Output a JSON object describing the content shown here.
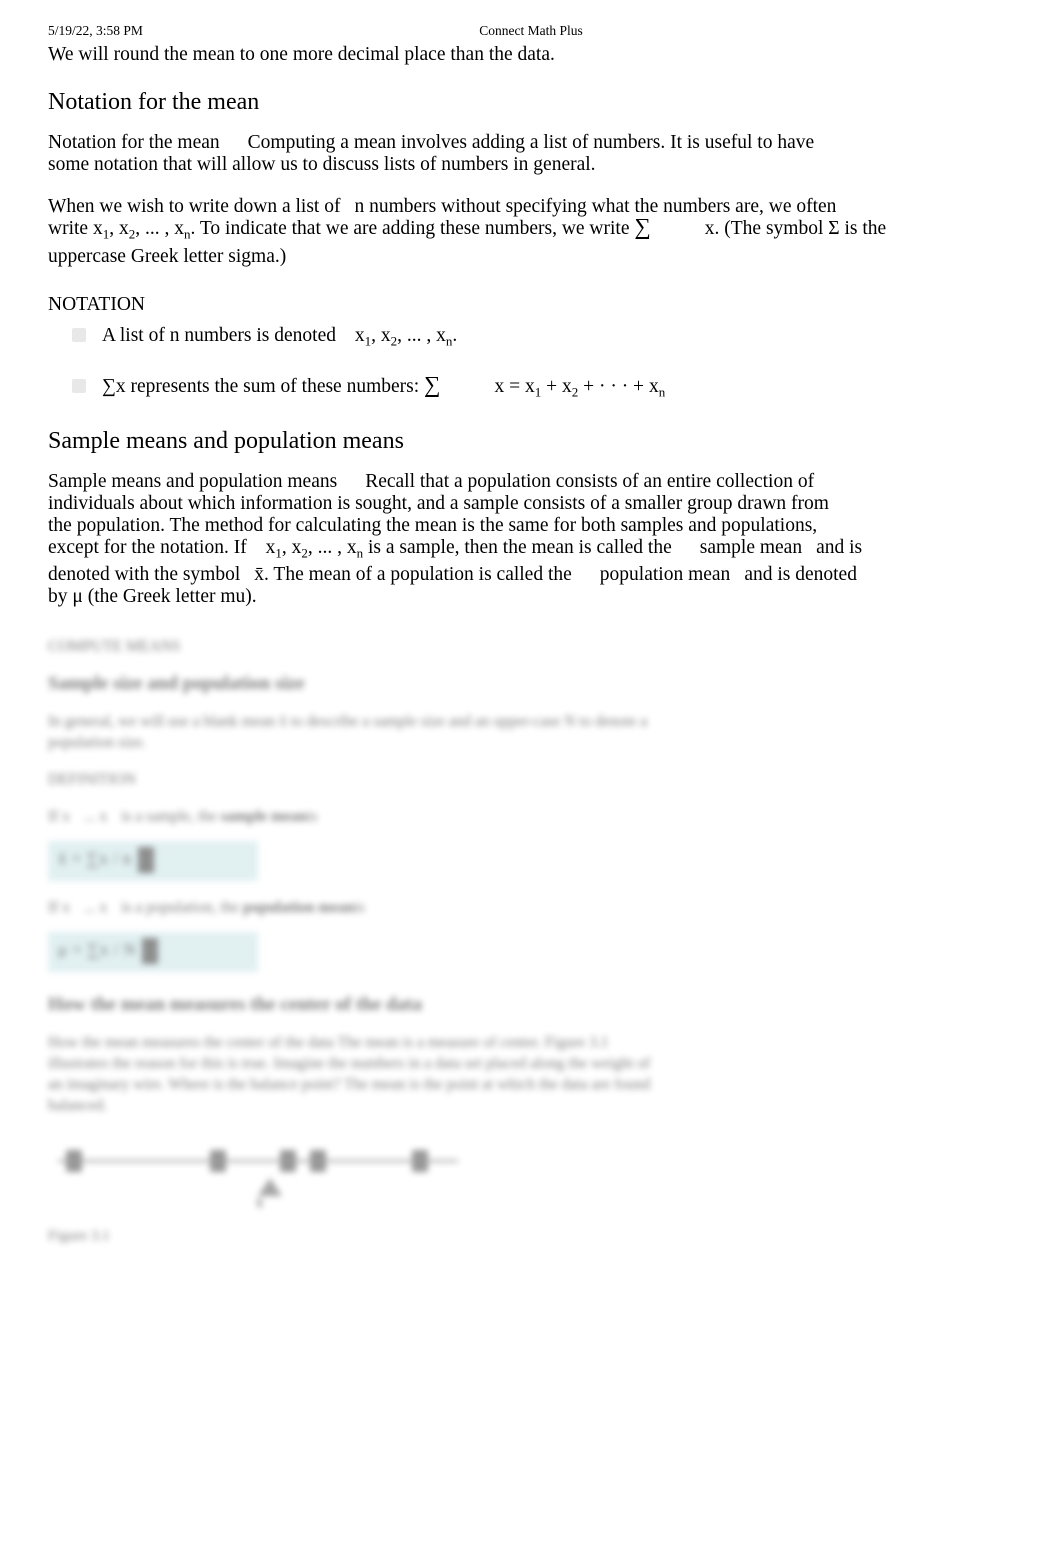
{
  "header": {
    "date": "5/19/22, 3:58 PM",
    "title": "Connect Math Plus"
  },
  "intro": {
    "rounding_note": "We will round the mean to one more decimal place than the data."
  },
  "sections": [
    {
      "heading": "Notation for the mean",
      "lead_label": "Notation for the mean",
      "paragraph_1a": "Computing a mean involves adding a list of numbers. It is useful to have",
      "paragraph_1b": "some notation that will allow us to discuss lists of numbers in general.",
      "paragraph_2": {
        "line1_a": "When we wish to write down a list of",
        "line1_b": "n numbers without specifying what the numbers are, we often",
        "line2_a": "write",
        "line2_x1": "x",
        "line2_sub1": "1",
        "line2_x2": "x",
        "line2_sub2": "2",
        "line2_ellipsis": ", ... ,",
        "line2_xn": "x",
        "line2_subn": "n",
        "line2_b": ". To indicate that we are adding these numbers, we write",
        "line2_sigma": "∑",
        "line2_c": "x. (The symbol Σ is the",
        "line3": "uppercase Greek letter sigma.)"
      },
      "notation_label": "NOTATION",
      "bullets": [
        {
          "text_a": "A list of",
          "text_n": "n numbers is denoted",
          "x1": "x",
          "s1": "1",
          "x2": "x",
          "s2": "2",
          "ellipsis": ", ... ,",
          "xn": "x",
          "sn": "n",
          "period": "."
        },
        {
          "text_a": "∑x represents the sum of these numbers:",
          "sigma": "∑",
          "eq": "x = x",
          "s1": "1",
          "plus1": "+ x",
          "s2": "2",
          "plus2": "+ · · · +",
          "xn": "x",
          "sn": "n"
        }
      ]
    },
    {
      "heading": "Sample means and population means",
      "lead_label": "Sample means and population means",
      "paragraph": {
        "line1_b": "Recall that a population consists of an entire collection of",
        "line2": "individuals about which information is sought, and a sample consists of a smaller group drawn from",
        "line3": "the population. The method for calculating the mean is the same for both samples and populations,",
        "line4_a": "except for the notation. If",
        "line4_x1": "x",
        "line4_s1": "1",
        "line4_x2": "x",
        "line4_s2": "2",
        "line4_ellipsis": ", ... ,",
        "line4_xn": "x",
        "line4_sn": "n",
        "line4_b": "is a sample, then the mean is called the",
        "line4_em": "sample mean",
        "line4_c": "and is",
        "line5_a": "denoted with the symbol",
        "line5_symbol": "x̄",
        "line5_b": ". The mean of a population is called the",
        "line5_em": "population mean",
        "line5_c": "and is denoted",
        "line6": "by μ (the Greek letter mu)."
      }
    }
  ],
  "blurred": {
    "label_definition_1": "COMPUTE MEANS",
    "heading_1": "Sample size and population size",
    "paragraph_1a": "In general, we will use a blank mean x̄ to describe a sample size and an upper-case N to denote a",
    "paragraph_1b": "population size.",
    "label_definition_2": "DEFINITION",
    "def_line_1a": "If x",
    "def_line_1b": "... x",
    "def_line_1c": "is a sample, the",
    "def_line_1d": "sample mean",
    "def_line_1e": "is",
    "formula_1": "x̄ = ∑x / n",
    "def_line_2a": "If x",
    "def_line_2b": "... x",
    "def_line_2c": "is a population, the",
    "def_line_2d": "population mean",
    "def_line_2e": "is",
    "formula_2": "μ = ∑x / N",
    "heading_2": "How the mean measures the center of the data",
    "paragraph_2a": "How the mean measures the center of the data     The mean is a measure of center. Figure 3.1",
    "paragraph_2b": "illustrates the reason for this is true. Imagine the numbers in a data set placed along the weight of",
    "paragraph_2c": "an imaginary wire. Where is the balance point? The mean is the point at which the data are found",
    "paragraph_2d": "balanced.",
    "figure_caption": "Figure 3.1",
    "figure_triangle_label": "x̄"
  }
}
